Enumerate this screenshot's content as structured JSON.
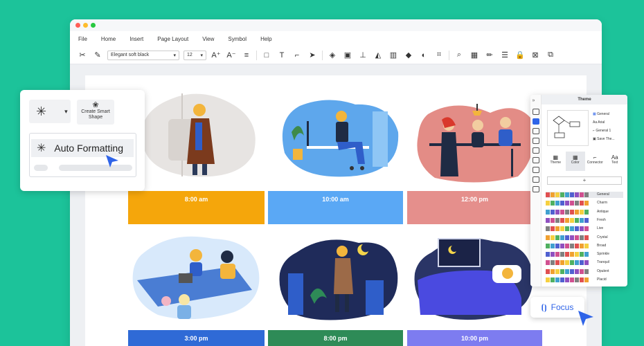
{
  "menu": [
    "File",
    "Home",
    "Insert",
    "Page Layout",
    "View",
    "Symbol",
    "Help"
  ],
  "toolbar": {
    "font_name": "Elegant soft black",
    "font_size": "12"
  },
  "cards": [
    {
      "time": "8:00 am",
      "color": "#f5a60b"
    },
    {
      "time": "10:00 am",
      "color": "#5aa8f5"
    },
    {
      "time": "12:00 pm",
      "color": "#e58f8c"
    },
    {
      "time": "3:00 pm",
      "color": "#2f6ad6"
    },
    {
      "time": "8:00 pm",
      "color": "#2e8b57"
    },
    {
      "time": "10:00 pm",
      "color": "#7d7cf0"
    }
  ],
  "panel": {
    "create_smart_shape": "Create Smart Shape",
    "auto_formatting": "Auto Formatting"
  },
  "theme_panel": {
    "title": "Theme",
    "side_options": [
      "General",
      "Arial",
      "General 1",
      "Save The..."
    ],
    "tabs": [
      "Theme",
      "Color",
      "Connector",
      "Text"
    ],
    "add_label": "+",
    "palettes": [
      "General",
      "Charm",
      "Antique",
      "Fresh",
      "Live",
      "Crystal",
      "Broad",
      "Sprinkle",
      "Tranquil",
      "Opulent",
      "Placid"
    ]
  },
  "focus": {
    "label": "Focus"
  }
}
